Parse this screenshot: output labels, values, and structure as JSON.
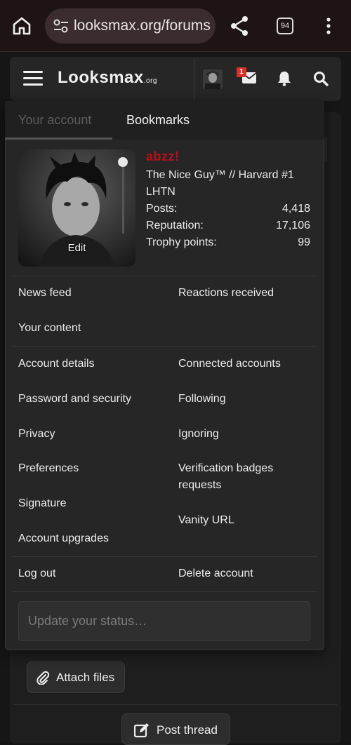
{
  "browser": {
    "url": "looksmax.org/forums",
    "tab_count": "94"
  },
  "header": {
    "logo_main_pre": "L",
    "logo_main_oo": "oo",
    "logo_main_post": "ksmax",
    "logo_tld": ".org",
    "mail_badge": "1"
  },
  "account_menu": {
    "tabs": [
      {
        "label": "Your account",
        "active": true
      },
      {
        "label": "Bookmarks",
        "active": false
      }
    ],
    "profile": {
      "edit_label": "Edit",
      "username": "abzz!",
      "title": "The Nice Guy™ // Harvard #1",
      "subtitle": "LHTN",
      "stats": [
        {
          "label": "Posts:",
          "value": "4,418"
        },
        {
          "label": "Reputation:",
          "value": "17,106"
        },
        {
          "label": "Trophy points:",
          "value": "99"
        }
      ]
    },
    "links": {
      "news_feed": "News feed",
      "reactions_received": "Reactions received",
      "your_content": "Your content",
      "account_details": "Account details",
      "connected_accounts": "Connected accounts",
      "password_security": "Password and security",
      "following": "Following",
      "privacy": "Privacy",
      "ignoring": "Ignoring",
      "preferences": "Preferences",
      "verification_badges": "Verification badges requests",
      "signature": "Signature",
      "vanity_url": "Vanity URL",
      "account_upgrades": "Account upgrades",
      "log_out": "Log out",
      "delete_account": "Delete account"
    },
    "status_placeholder": "Update your status…"
  },
  "editor": {
    "attach_label": "Attach files",
    "post_label": "Post thread"
  },
  "colors": {
    "username": "#b8101a",
    "badge": "#d9322a"
  }
}
